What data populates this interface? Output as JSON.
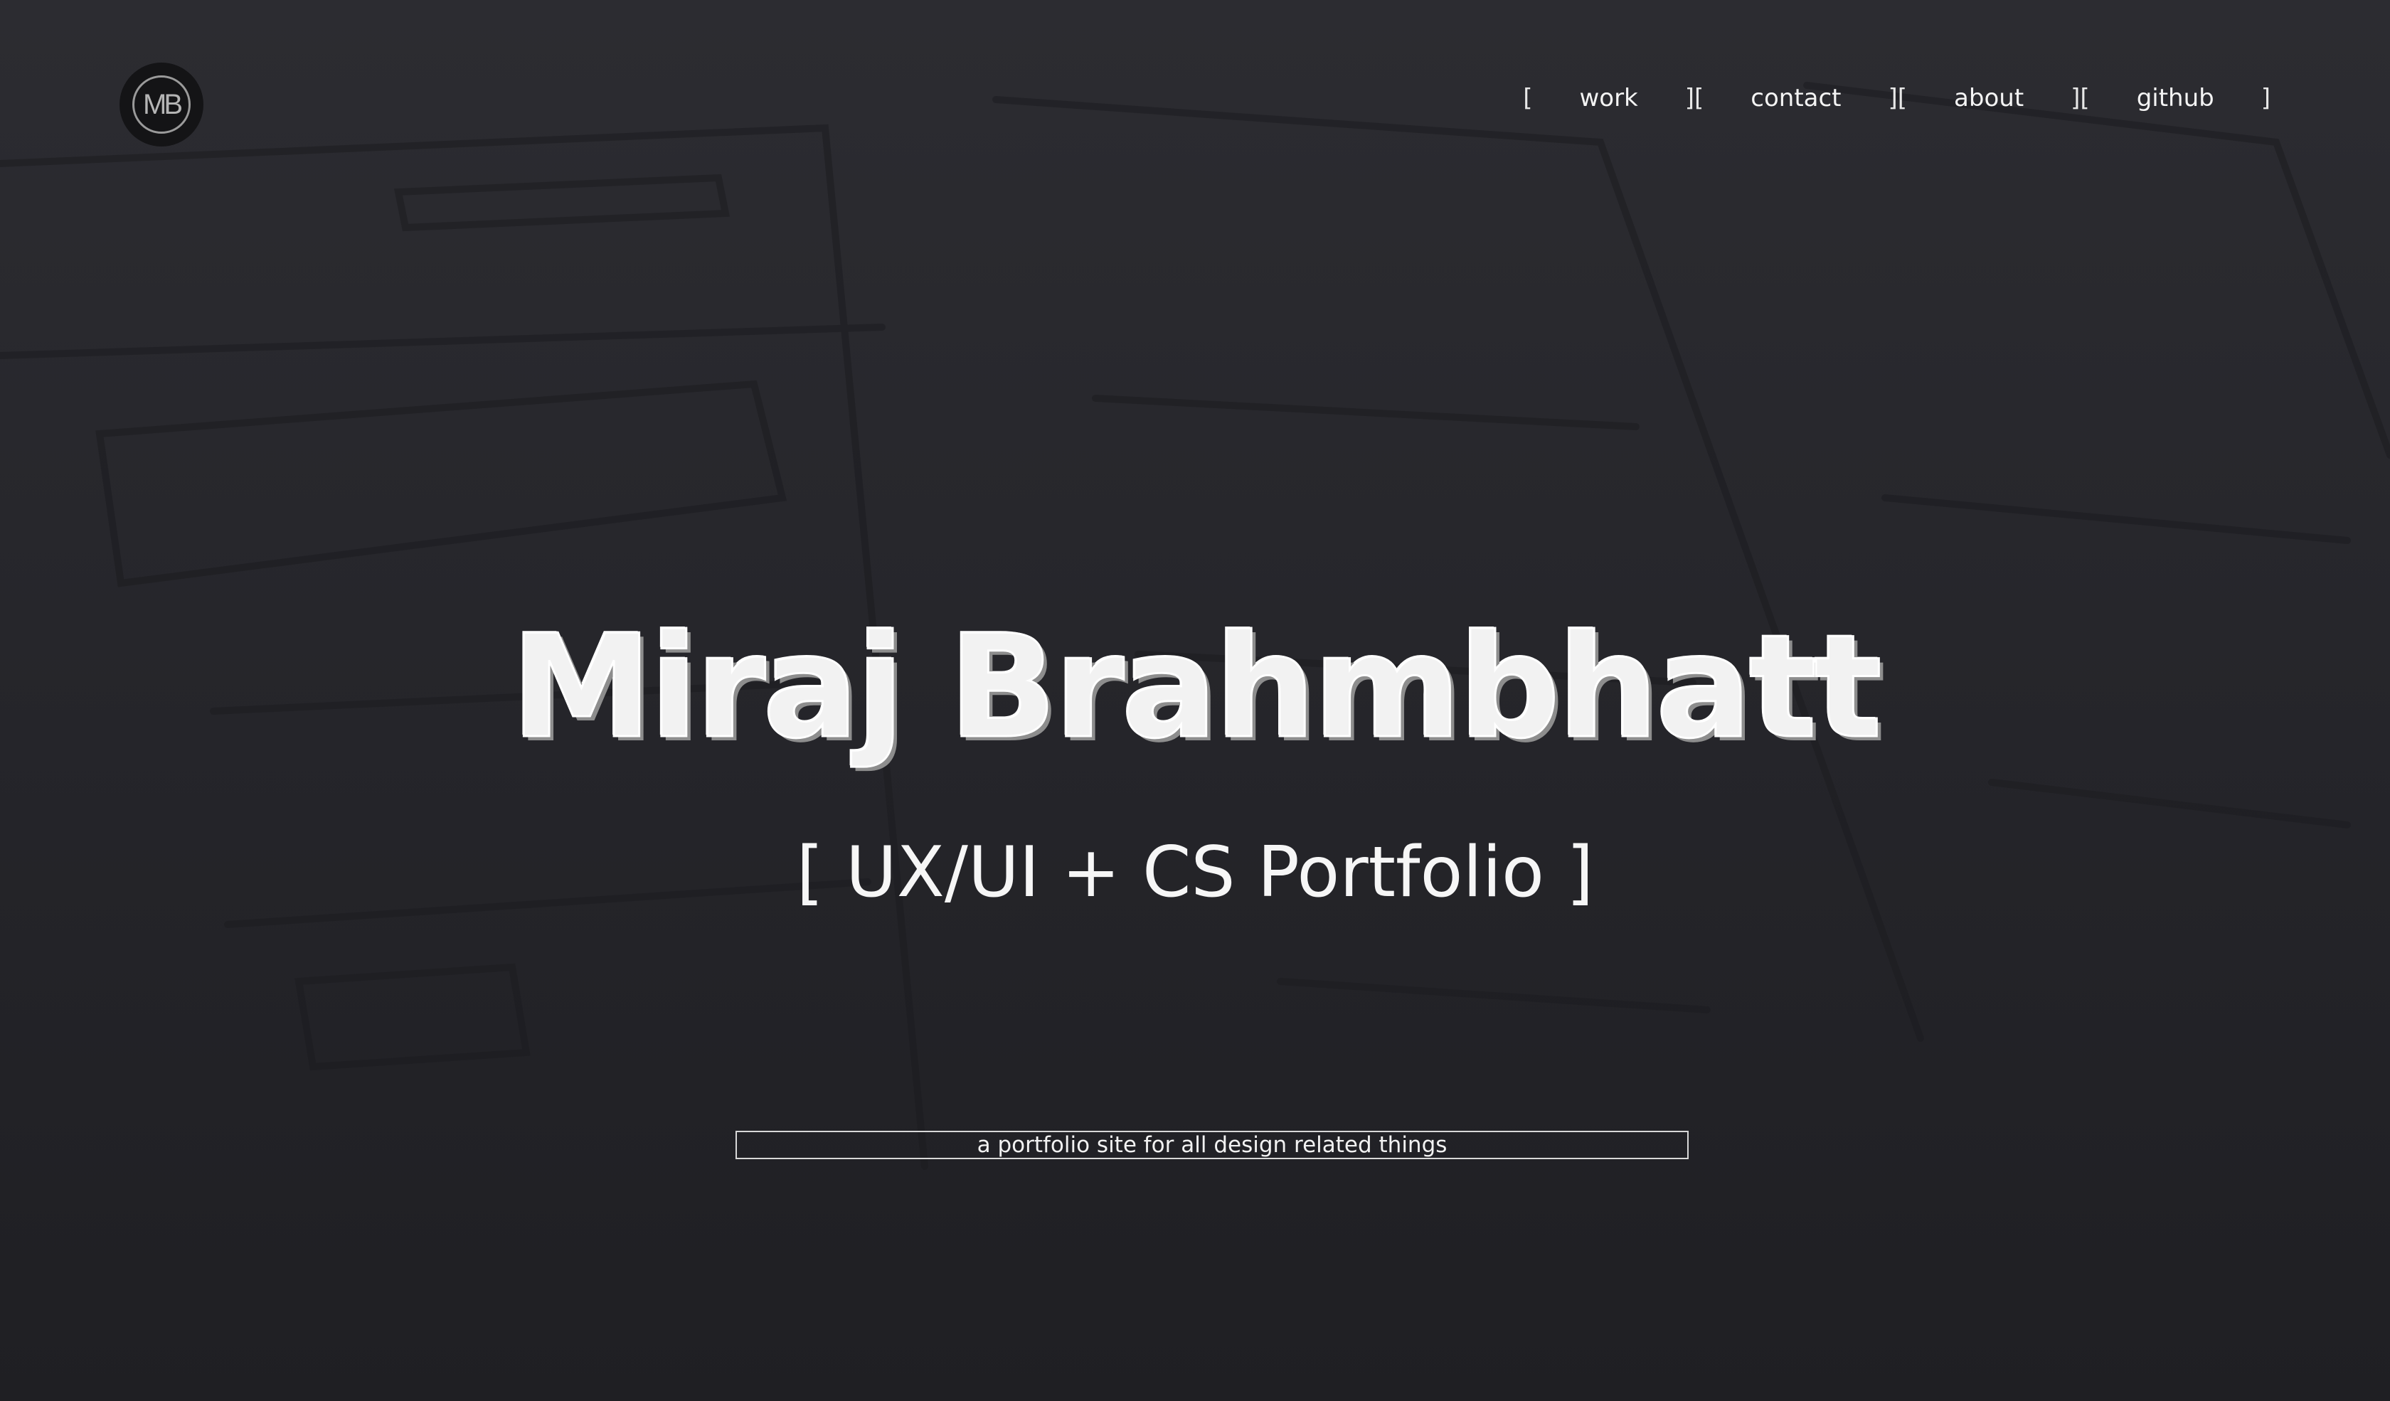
{
  "logo": {
    "text": "MB",
    "icon": "monogram-logo-icon"
  },
  "nav": {
    "open_bracket": "[",
    "separator": "][",
    "close_bracket": "]",
    "items": [
      {
        "label": "work"
      },
      {
        "label": "contact"
      },
      {
        "label": "about"
      },
      {
        "label": "github"
      }
    ]
  },
  "hero": {
    "name": "Miraj Brahmbhatt",
    "subtitle": "[ UX/UI + CS Portfolio ]",
    "tagline": "a portfolio site for all design related things"
  },
  "colors": {
    "background": "#26262b",
    "text": "#ffffff",
    "name_shadow": "#8d8d8d"
  }
}
